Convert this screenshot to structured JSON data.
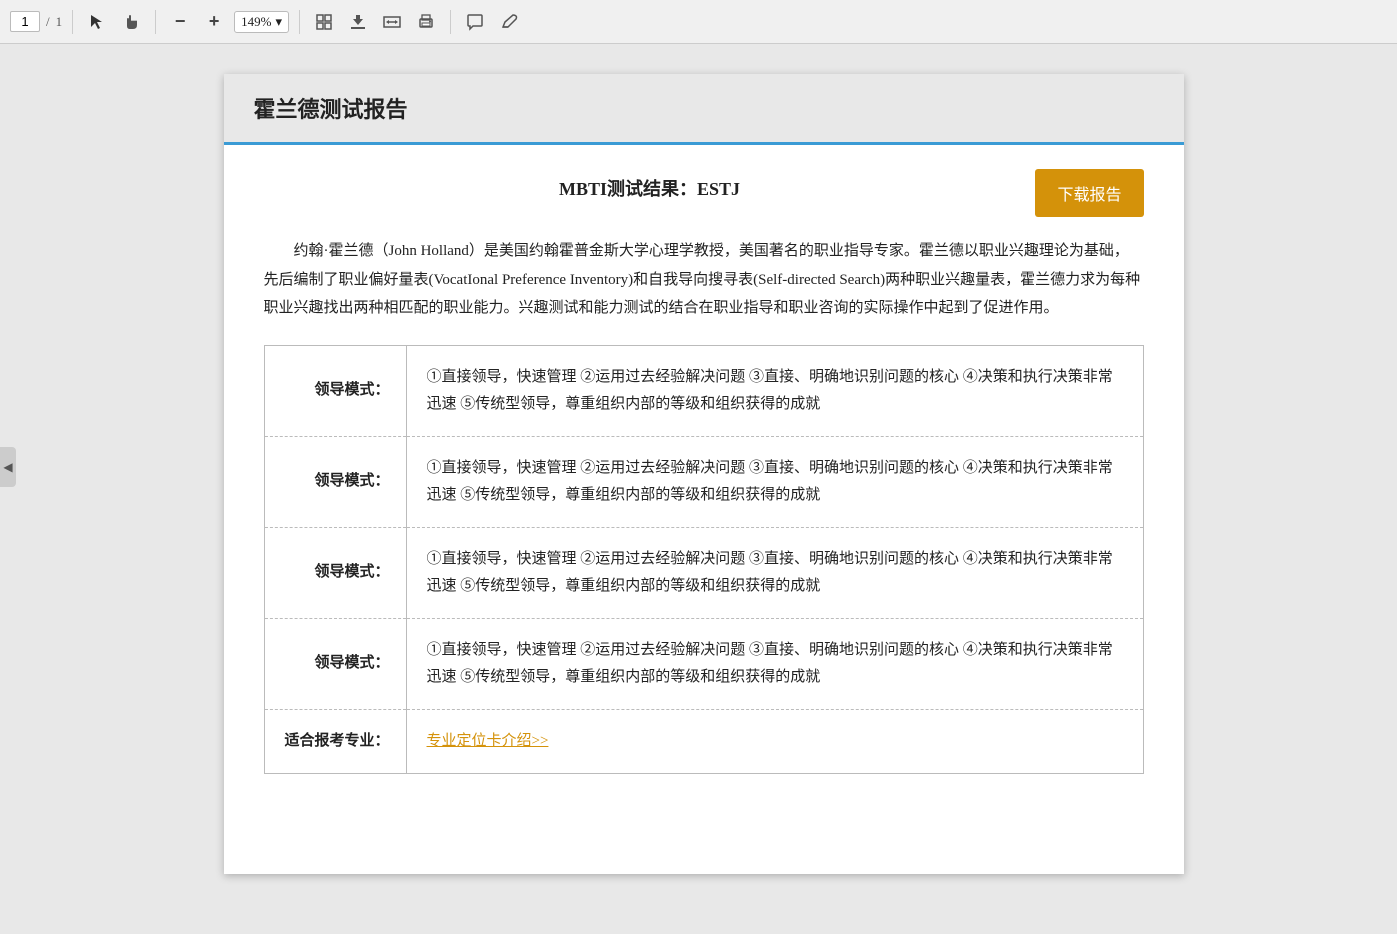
{
  "toolbar": {
    "current_page": "1",
    "total_pages": "1",
    "zoom_level": "149%",
    "arrow_icon": "◀"
  },
  "header": {
    "title": "霍兰德测试报告",
    "border_color": "#3a9bd5"
  },
  "mbti": {
    "result_label": "MBTI测试结果：",
    "result_value": "ESTJ"
  },
  "download_btn": {
    "label": "下载报告"
  },
  "description": {
    "text": "约翰·霍兰德（John  Holland）是美国约翰霍普金斯大学心理学教授，美国著名的职业指导专家。霍兰德以职业兴趣理论为基础，先后编制了职业偏好量表(VocatIonal  Preference  Inventory)和自我导向搜寻表(Self-directed  Search)两种职业兴趣量表，霍兰德力求为每种职业兴趣找出两种相匹配的职业能力。兴趣测试和能力测试的结合在职业指导和职业咨询的实际操作中起到了促进作用。"
  },
  "table": {
    "rows": [
      {
        "label": "领导模式：",
        "content": "①直接领导，快速管理 ②运用过去经验解决问题 ③直接、明确地识别问题的核心 ④决策和执行决策非常迅速 ⑤传统型领导，尊重组织内部的等级和组织获得的成就"
      },
      {
        "label": "领导模式：",
        "content": "①直接领导，快速管理 ②运用过去经验解决问题 ③直接、明确地识别问题的核心 ④决策和执行决策非常迅速 ⑤传统型领导，尊重组织内部的等级和组织获得的成就"
      },
      {
        "label": "领导模式：",
        "content": "①直接领导，快速管理 ②运用过去经验解决问题 ③直接、明确地识别问题的核心 ④决策和执行决策非常迅速 ⑤传统型领导，尊重组织内部的等级和组织获得的成就"
      },
      {
        "label": "领导模式：",
        "content": "①直接领导，快速管理 ②运用过去经验解决问题 ③直接、明确地识别问题的核心 ④决策和执行决策非常迅速 ⑤传统型领导，尊重组织内部的等级和组织获得的成就"
      },
      {
        "label": "适合报考专业：",
        "content": "",
        "link_text": "专业定位卡介绍>>",
        "is_link_row": true
      }
    ]
  }
}
